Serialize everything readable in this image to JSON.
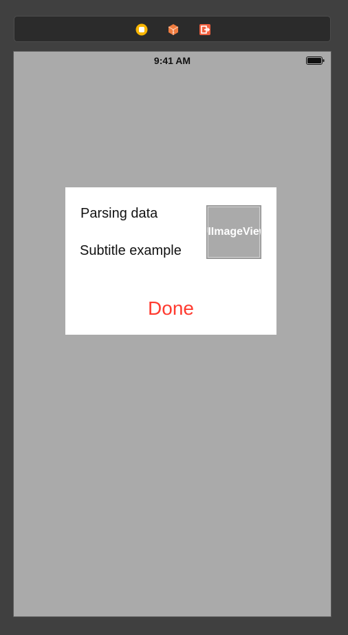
{
  "toolbar": {
    "icons": [
      "view-controller-icon",
      "first-responder-icon",
      "exit-icon"
    ],
    "colors": {
      "viewController": "#f7b500",
      "firstResponder": "#f07c3f",
      "exit": "#f0603f"
    }
  },
  "status_bar": {
    "time": "9:41 AM"
  },
  "dialog": {
    "title": "Parsing data",
    "subtitle": "Subtitle example",
    "image_view_label": "UIImageView",
    "done_label": "Done",
    "done_color": "#ff3b30"
  }
}
